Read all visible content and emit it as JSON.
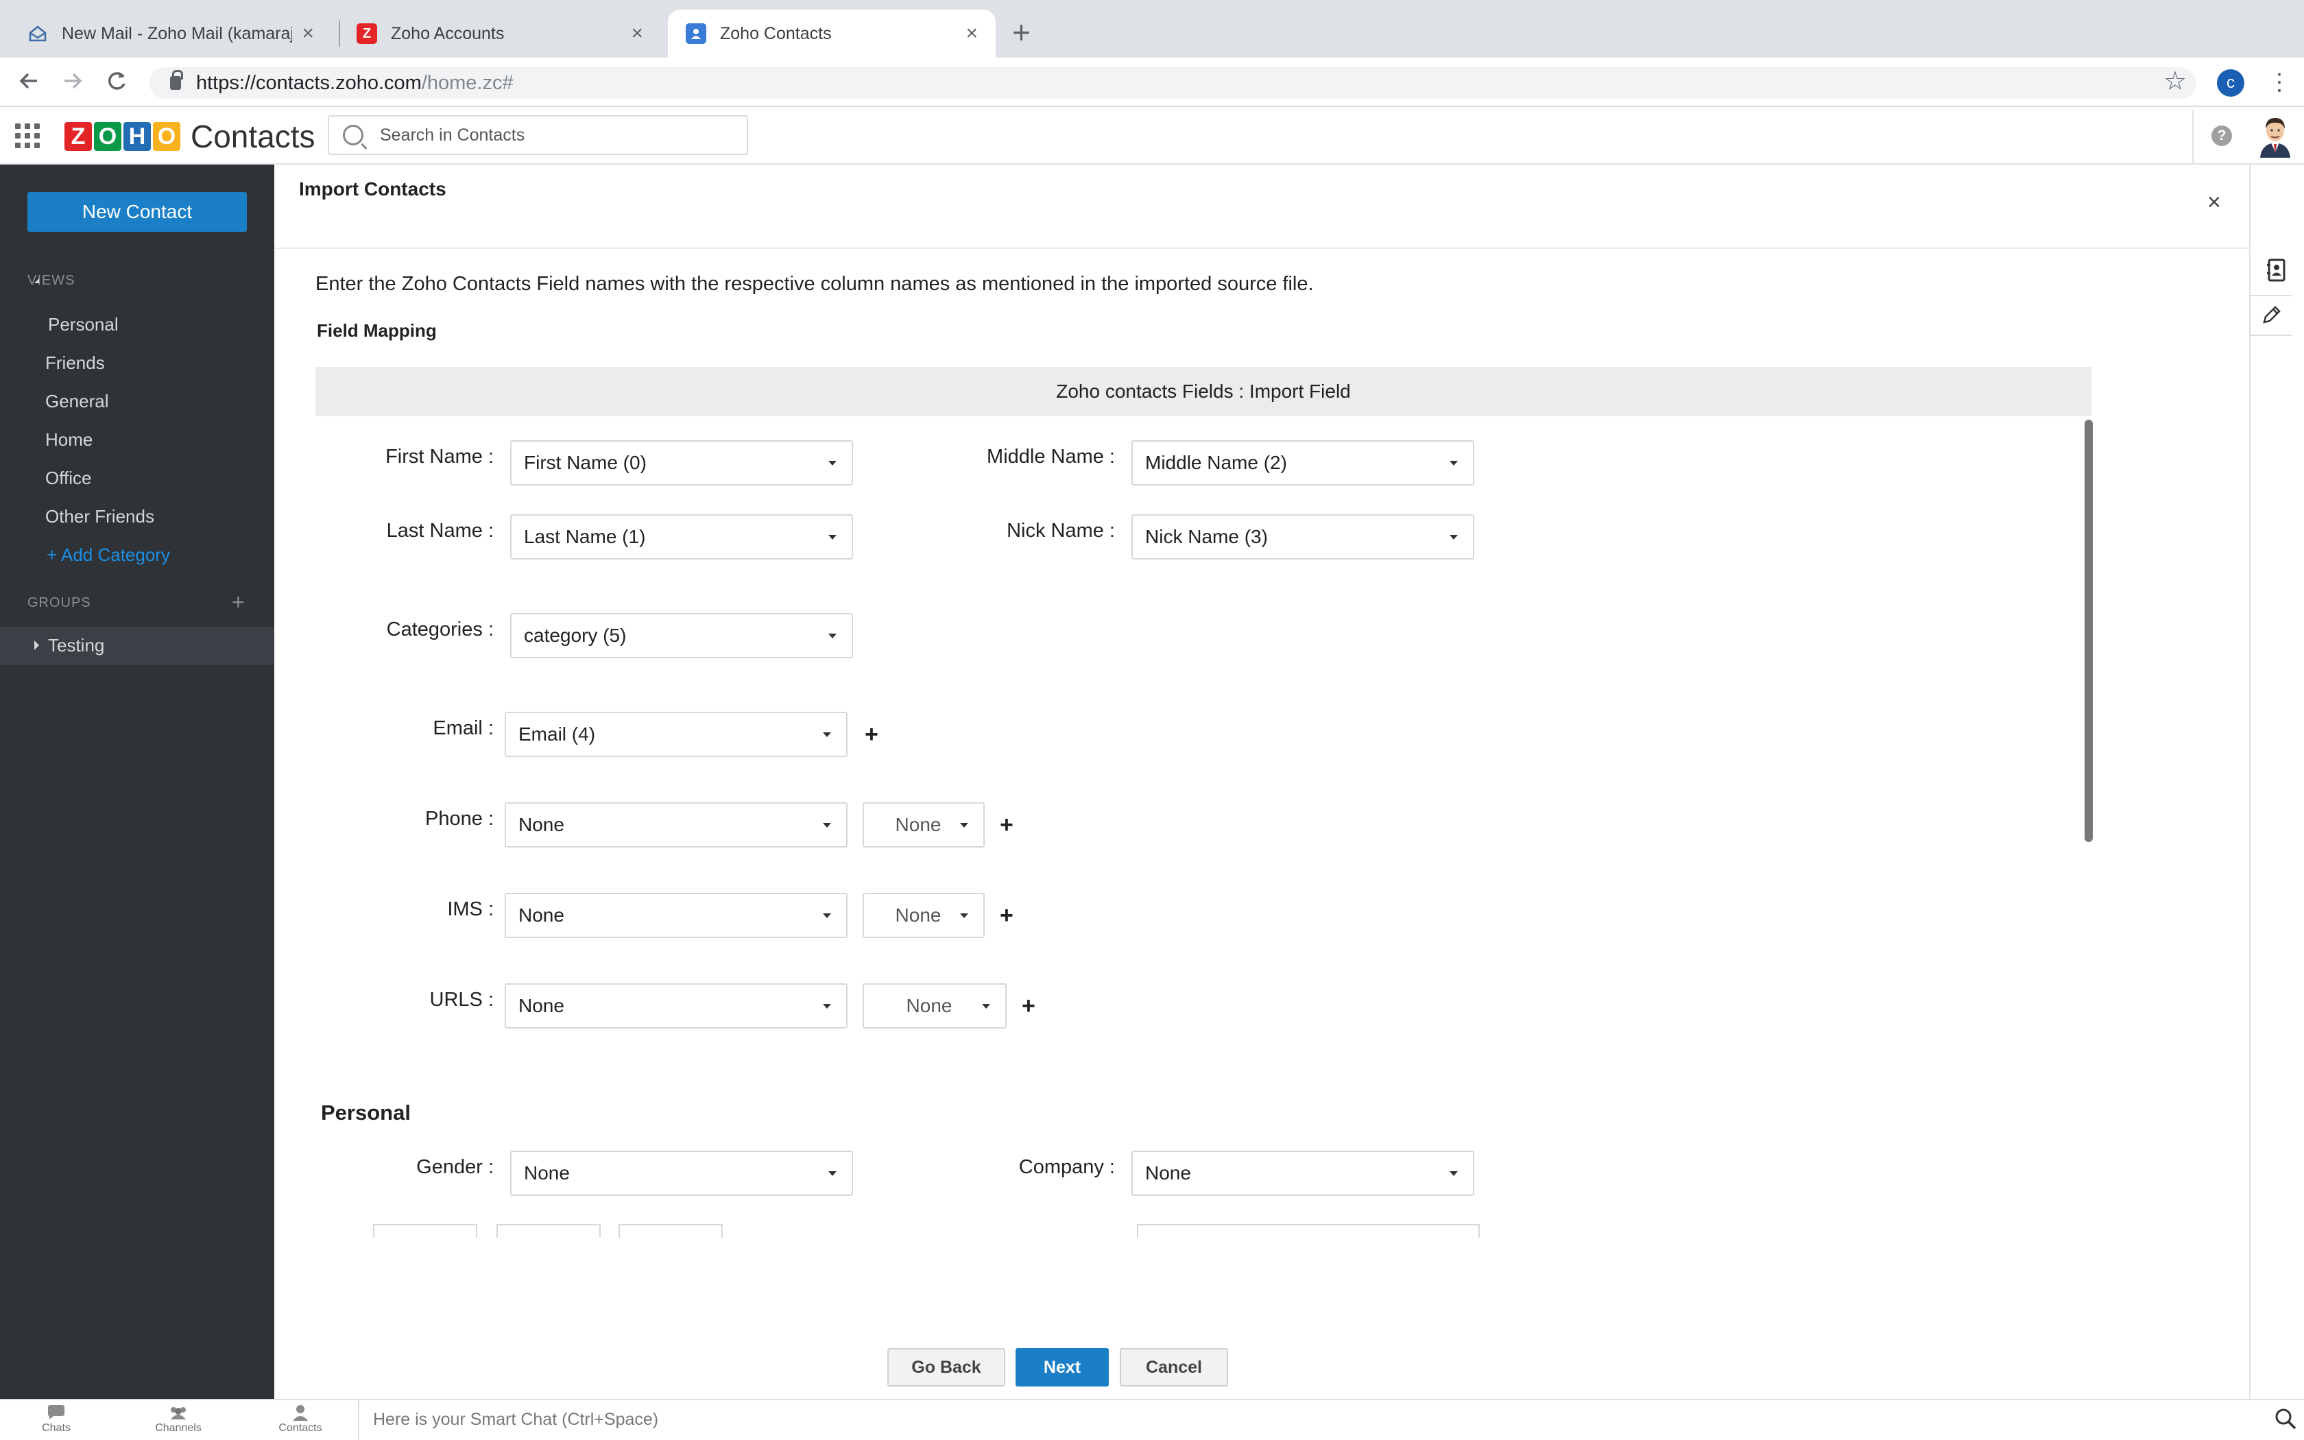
{
  "browser": {
    "tabs": [
      {
        "title": "New Mail - Zoho Mail (kamaraj",
        "icon": "mail-icon"
      },
      {
        "title": "Zoho Accounts",
        "icon": "zoho-z-icon"
      },
      {
        "title": "Zoho Contacts",
        "icon": "contacts-icon",
        "active": true
      }
    ],
    "close_glyph": "×",
    "new_tab_glyph": "+",
    "url_host": "https://contacts.zoho.com",
    "url_path": "/home.zc#",
    "profile_initial": "c"
  },
  "app": {
    "logo_letters": [
      "Z",
      "O",
      "H",
      "O"
    ],
    "logo_colors": [
      "#e42527",
      "#089949",
      "#226db4",
      "#f9b21d"
    ],
    "name": "Contacts",
    "search_placeholder": "Search in Contacts",
    "help_glyph": "?"
  },
  "sidebar": {
    "new_contact": "New Contact",
    "views_heading": "VIEWS",
    "views": [
      "Personal",
      "Friends",
      "General",
      "Home",
      "Office",
      "Other Friends"
    ],
    "add_category": "+ Add Category",
    "groups_heading": "GROUPS",
    "groups_add": "+",
    "groups": [
      "Testing"
    ]
  },
  "import": {
    "title": "Import Contacts",
    "close": "×",
    "instructions": "Enter the Zoho Contacts Field names with the respective column names as mentioned in the imported source file.",
    "field_mapping": "Field Mapping",
    "table_header": "Zoho contacts Fields :  Import Field",
    "fields": {
      "first_name": {
        "label": "First Name :",
        "value": "First Name (0)"
      },
      "middle_name": {
        "label": "Middle Name :",
        "value": "Middle Name (2)"
      },
      "last_name": {
        "label": "Last Name :",
        "value": "Last Name (1)"
      },
      "nick_name": {
        "label": "Nick Name :",
        "value": "Nick Name (3)"
      },
      "categories": {
        "label": "Categories :",
        "value": "category (5)"
      },
      "email": {
        "label": "Email :",
        "value": "Email (4)"
      },
      "phone": {
        "label": "Phone :",
        "value": "None",
        "type": "None"
      },
      "ims": {
        "label": "IMS :",
        "value": "None",
        "type": "None"
      },
      "urls": {
        "label": "URLS :",
        "value": "None",
        "type": "None"
      }
    },
    "add_glyph": "+",
    "personal_heading": "Personal",
    "personal": {
      "gender": {
        "label": "Gender :",
        "value": "None"
      },
      "company": {
        "label": "Company :",
        "value": "None"
      }
    },
    "buttons": {
      "back": "Go Back",
      "next": "Next",
      "cancel": "Cancel"
    }
  },
  "bottom_bar": {
    "chats": "Chats",
    "channels": "Channels",
    "contacts": "Contacts",
    "smart_chat_placeholder": "Here is your Smart Chat (Ctrl+Space)"
  }
}
